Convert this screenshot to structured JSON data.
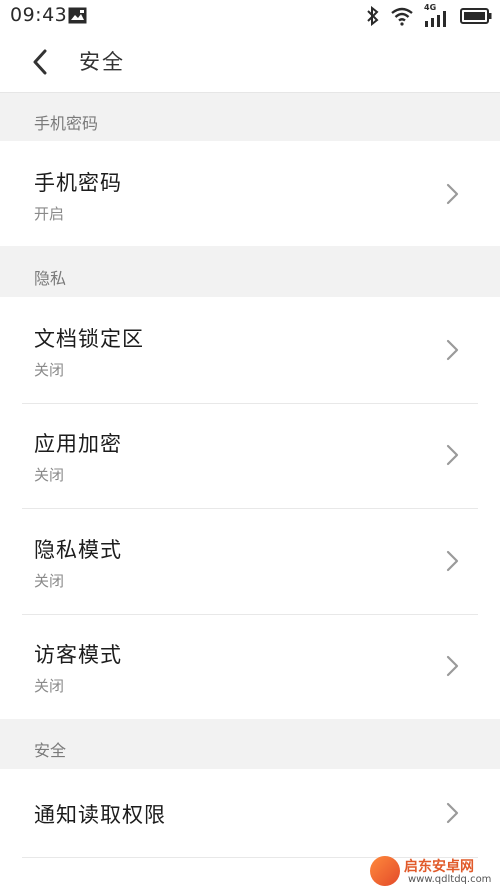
{
  "status_bar": {
    "time": "09:43",
    "network": "4G",
    "icons": [
      "image-notification-icon",
      "bluetooth-icon",
      "wifi-icon",
      "signal-icon",
      "battery-icon"
    ]
  },
  "app_bar": {
    "title": "安全",
    "back_icon": "chevron-left-icon"
  },
  "sections": {
    "phone_password": {
      "header": "手机密码",
      "items": [
        {
          "title": "手机密码",
          "subtitle": "开启"
        }
      ]
    },
    "privacy": {
      "header": "隐私",
      "items": [
        {
          "title": "文档锁定区",
          "subtitle": "关闭"
        },
        {
          "title": "应用加密",
          "subtitle": "关闭"
        },
        {
          "title": "隐私模式",
          "subtitle": "关闭"
        },
        {
          "title": "访客模式",
          "subtitle": "关闭"
        }
      ]
    },
    "security": {
      "header": "安全",
      "items": [
        {
          "title": "通知读取权限"
        }
      ]
    }
  },
  "watermark": {
    "text": "启东安卓网",
    "url": "www.qdltdq.com"
  },
  "colors": {
    "section_background": "#f2f2f2",
    "accent_watermark": "#e15a2a"
  }
}
